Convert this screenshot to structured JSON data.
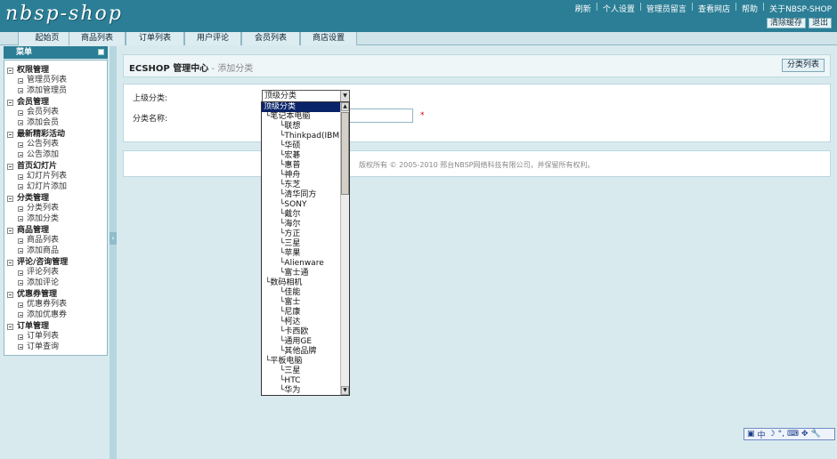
{
  "header": {
    "logo": "nbsp-shop",
    "links": [
      "刷新",
      "个人设置",
      "管理员留言",
      "查看网店",
      "帮助",
      "关于NBSP-SHOP"
    ],
    "buttons": [
      "清除缓存",
      "退出"
    ]
  },
  "nav": {
    "tabs": [
      "起始页",
      "商品列表",
      "订单列表",
      "用户评论",
      "会员列表",
      "商店设置"
    ]
  },
  "sidebar": {
    "title": "菜单",
    "groups": [
      {
        "title": "权限管理",
        "items": [
          "管理员列表",
          "添加管理员"
        ]
      },
      {
        "title": "会员管理",
        "items": [
          "会员列表",
          "添加会员"
        ]
      },
      {
        "title": "最新精彩活动",
        "items": [
          "公告列表",
          "公告添加"
        ]
      },
      {
        "title": "首页幻灯片",
        "items": [
          "幻灯片列表",
          "幻灯片添加"
        ]
      },
      {
        "title": "分类管理",
        "items": [
          "分类列表",
          "添加分类"
        ]
      },
      {
        "title": "商品管理",
        "items": [
          "商品列表",
          "添加商品"
        ]
      },
      {
        "title": "评论/咨询管理",
        "items": [
          "评论列表",
          "添加评论"
        ]
      },
      {
        "title": "优惠券管理",
        "items": [
          "优惠券列表",
          "添加优惠券"
        ]
      },
      {
        "title": "订单管理",
        "items": [
          "订单列表",
          "订单查询"
        ]
      }
    ]
  },
  "content": {
    "title": "ECSHOP 管理中心",
    "subtitle": " - 添加分类",
    "list_button": "分类列表"
  },
  "form": {
    "parent_label": "上级分类:",
    "parent_selected": "顶级分类",
    "name_label": "分类名称:",
    "required_mark": "*"
  },
  "footer": {
    "copyright": "版权所有 © 2005-2010 邢台NBSP网络科技有限公司，并保留所有权利。"
  },
  "dropdown": {
    "options": [
      {
        "label": "顶级分类",
        "level": 0,
        "selected": true
      },
      {
        "label": "笔记本电脑",
        "level": 1
      },
      {
        "label": "联想",
        "level": 2
      },
      {
        "label": "Thinkpad(IBM)",
        "level": 2
      },
      {
        "label": "华硕",
        "level": 2
      },
      {
        "label": "宏碁",
        "level": 2
      },
      {
        "label": "惠普",
        "level": 2
      },
      {
        "label": "神舟",
        "level": 2
      },
      {
        "label": "东芝",
        "level": 2
      },
      {
        "label": "清华同方",
        "level": 2
      },
      {
        "label": "SONY",
        "level": 2
      },
      {
        "label": "戴尔",
        "level": 2
      },
      {
        "label": "海尔",
        "level": 2
      },
      {
        "label": "方正",
        "level": 2
      },
      {
        "label": "三星",
        "level": 2
      },
      {
        "label": "苹果",
        "level": 2
      },
      {
        "label": "Alienware",
        "level": 2
      },
      {
        "label": "富士通",
        "level": 2
      },
      {
        "label": "数码相机",
        "level": 1
      },
      {
        "label": "佳能",
        "level": 2
      },
      {
        "label": "富士",
        "level": 2
      },
      {
        "label": "尼康",
        "level": 2
      },
      {
        "label": "柯达",
        "level": 2
      },
      {
        "label": "卡西欧",
        "level": 2
      },
      {
        "label": "通用GE",
        "level": 2
      },
      {
        "label": "其他品牌",
        "level": 2
      },
      {
        "label": "平板电脑",
        "level": 1
      },
      {
        "label": "三星",
        "level": 2
      },
      {
        "label": "HTC",
        "level": 2
      },
      {
        "label": "华为",
        "level": 2
      }
    ]
  },
  "ime": {
    "items": [
      "中",
      "☽",
      "°,",
      "⌨",
      "✥",
      "🔧"
    ]
  }
}
